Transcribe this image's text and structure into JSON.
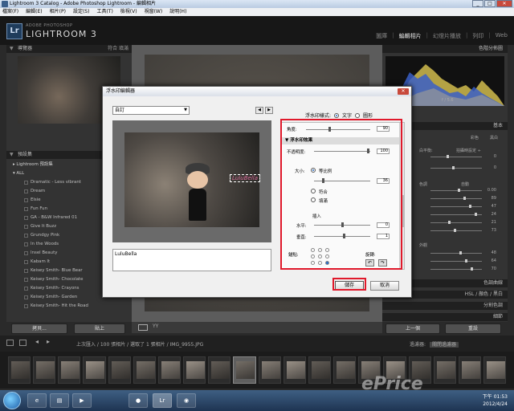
{
  "window": {
    "title": "Lightroom 3 Catalog - Adobe Photoshop Lightroom - 編輯相片",
    "buttons": [
      "_",
      "□",
      "✕"
    ]
  },
  "menu": [
    "檔案(F)",
    "編輯(E)",
    "相片(P)",
    "設定(S)",
    "工具(T)",
    "檢視(V)",
    "視窗(W)",
    "說明(H)"
  ],
  "identity": {
    "adobe": "ADOBE PHOTOSHOP",
    "product": "LIGHTROOM 3",
    "logo": "Lr"
  },
  "modules": [
    "圖庫",
    "編輯相片",
    "幻燈片播放",
    "列印",
    "Web"
  ],
  "active_module": "編輯相片",
  "left": {
    "navigator": {
      "title": "導覽器",
      "opts": "符合  填滿"
    },
    "presets": {
      "title": "預設集",
      "folders": [
        "Lightroom 預設集",
        "ALL"
      ],
      "items": [
        "Dramatic - Less vibrant",
        "Dream",
        "Elsie",
        "Fun Fun",
        "GA - B&W Infrared 01",
        "Give It Buzz",
        "Grundgy Pink",
        "In the Woods",
        "Insel Beauty",
        "Kabam It",
        "Keisey Smith- Blue Bear",
        "Keisey Smith- Chocolate",
        "Keisey Smith- Crayons",
        "Keisey Smith- Garden",
        "Keisey Smith- Hit the Road"
      ]
    },
    "buttons": {
      "copy": "拷貝...",
      "paste": "貼上"
    }
  },
  "right": {
    "histogram_title": "色階分佈圖",
    "histogram_info": "f / 5.6",
    "basic_title": "基本",
    "color_label": "彩色",
    "bw_label": "黑白",
    "wb_label": "白平衡:",
    "wb_value": "拍攝時設定 ÷",
    "tone_label": "色調",
    "auto_label": "自動",
    "presence_label": "外觀",
    "slider_values": [
      "0",
      "0",
      "0.00",
      "89",
      "47",
      "24",
      "21",
      "73",
      "48",
      "64",
      "70"
    ],
    "panels": [
      "色調曲線",
      "HSL / 顏色 / 黑白",
      "分割色調",
      "細節"
    ],
    "buttons": {
      "prev": "上一個",
      "reset": "重設"
    }
  },
  "filmstrip": {
    "info": "上次匯入 / 100 張相片 / 選取了 1 張相片 / IMG_9955.JPG",
    "filter_label": "過濾器:",
    "filter_value": "關閉過濾器",
    "thumb_count": 20,
    "selected_index": 9
  },
  "dialog": {
    "title": "浮水印編輯器",
    "preset": "自訂",
    "watermark_style_label": "浮水印樣式:",
    "style_text": "文字",
    "style_graphic": "圖形",
    "watermark_text": "LuluBella",
    "top_partial": "角度:",
    "top_partial_value": "90",
    "section": "浮水印效果",
    "opacity_label": "不透明度:",
    "opacity_value": "100",
    "size_label": "大小:",
    "size_option1": "等比例",
    "size_value": "36",
    "size_option2": "符合",
    "size_option3": "填滿",
    "inset_label": "插入",
    "h_label": "水平:",
    "h_value": "0",
    "v_label": "垂直:",
    "v_value": "1",
    "anchor_label": "錨點:",
    "rotate_label": "旋轉:",
    "save": "儲存",
    "cancel": "取消"
  },
  "taskbar": {
    "time": "下午 01:53",
    "date": "2012/4/24"
  },
  "watermark": "ePrice"
}
